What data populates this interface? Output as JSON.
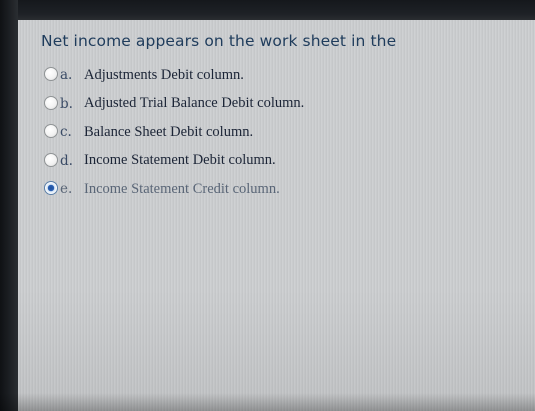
{
  "question": {
    "text": "Net income appears on the work sheet in the"
  },
  "options": [
    {
      "letter": "a.",
      "text": "Adjustments Debit column.",
      "selected": false
    },
    {
      "letter": "b.",
      "text": "Adjusted Trial Balance Debit column.",
      "selected": false
    },
    {
      "letter": "c.",
      "text": "Balance Sheet Debit column.",
      "selected": false
    },
    {
      "letter": "d.",
      "text": "Income Statement Debit column.",
      "selected": false
    },
    {
      "letter": "e.",
      "text": "Income Statement Credit column.",
      "selected": true
    }
  ],
  "colors": {
    "question_text": "#1f3c5c",
    "selected_radio": "#2c62b5",
    "panel_background": "#cdcfd1"
  },
  "icons": {
    "radio_unselected": "radio-button-empty-icon",
    "radio_selected": "radio-button-filled-icon"
  }
}
